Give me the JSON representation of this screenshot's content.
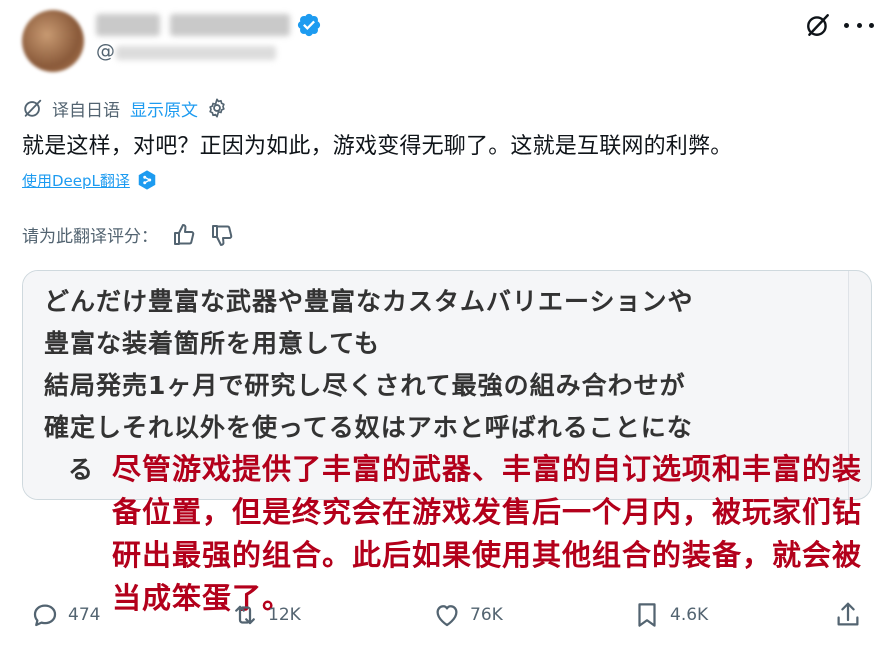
{
  "header": {
    "handle_prefix": "@"
  },
  "translation": {
    "source_label": "译自日语",
    "show_original": "显示原文"
  },
  "tweet": {
    "text": "就是这样，对吧？正因为如此，游戏变得无聊了。这就是互联网的利弊。"
  },
  "deepl": {
    "label": "使用DeepL翻译"
  },
  "rating": {
    "label": "请为此翻译评分："
  },
  "image": {
    "japanese_lines": [
      "どんだけ豊富な武器や豊富なカスタムバリエーションや",
      "豊富な装着箇所を用意しても",
      "結局発売1ヶ月で研究し尽くされて最強の組み合わせが",
      "確定しそれ以外を使ってる奴はアホと呼ばれることにな",
      "る"
    ],
    "chinese_translation": "尽管游戏提供了丰富的武器、丰富的自订选项和丰富的装备位置，但是终究会在游戏发售后一个月内，被玩家们钻研出最强的组合。此后如果使用其他组合的装备，就会被当成笨蛋了。",
    "overlay_color": "#b3001b"
  },
  "actions": {
    "replies": "474",
    "reposts": "12K",
    "likes": "76K",
    "bookmarks": "4.6K"
  },
  "colors": {
    "accent": "#1d9bf0",
    "muted": "#536471"
  }
}
